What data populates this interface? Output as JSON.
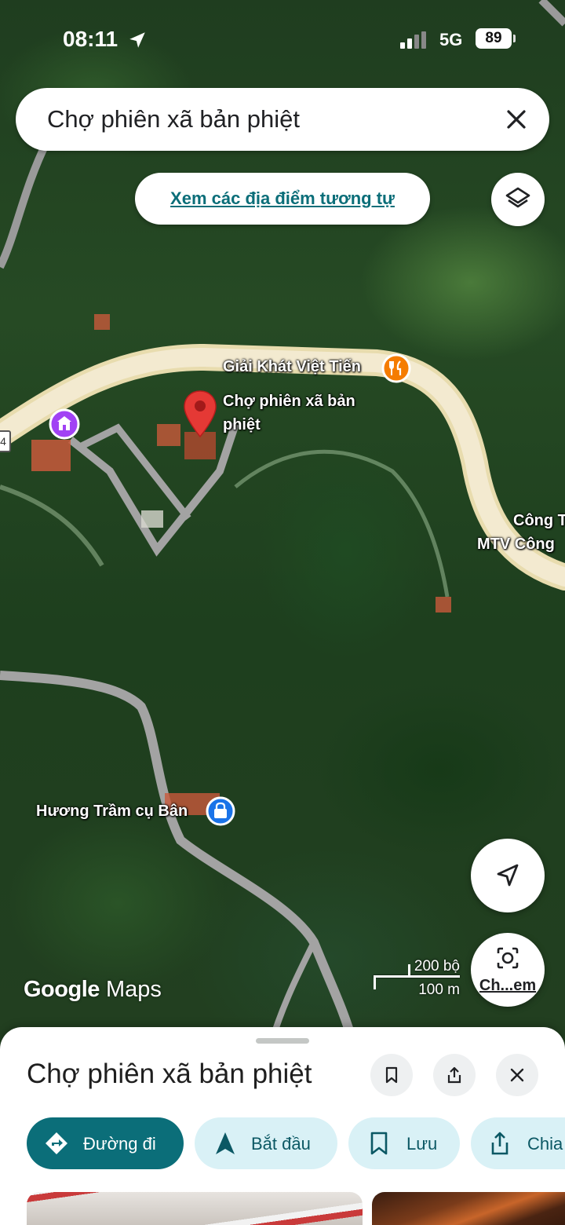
{
  "status_bar": {
    "time": "08:11",
    "network": "5G",
    "battery": "89"
  },
  "search": {
    "query": "Chợ phiên xã bản phiệt"
  },
  "similar_places_label": "Xem các địa điểm tương tự",
  "map": {
    "labels": {
      "restaurant": "Giải Khát Việt Tiến",
      "selected_place_line1": "Chợ phiên xã bản",
      "selected_place_line2": "phiệt",
      "company_line1": "Công T",
      "company_line2": "MTV Công",
      "shop": "Hương Trầm cụ Bân",
      "road_shield": "4"
    },
    "logo_part1": "Google",
    "logo_part2": "Maps",
    "scale": {
      "imperial": "200 bộ",
      "metric": "100 m"
    },
    "lens_label": "Ch...em"
  },
  "place_sheet": {
    "title": "Chợ phiên xã bản phiệt",
    "actions": [
      {
        "label": "Đường đi",
        "icon": "directions-icon"
      },
      {
        "label": "Bắt đầu",
        "icon": "navigation-arrow-icon"
      },
      {
        "label": "Lưu",
        "icon": "bookmark-icon"
      },
      {
        "label": "Chia",
        "icon": "share-icon"
      }
    ]
  },
  "colors": {
    "accent": "#0b6e79",
    "chip_bg": "#d9f1f6",
    "pin_red": "#e53935",
    "restaurant_orange": "#f57c00",
    "poi_purple": "#a142f4",
    "shop_blue": "#1a73e8"
  }
}
